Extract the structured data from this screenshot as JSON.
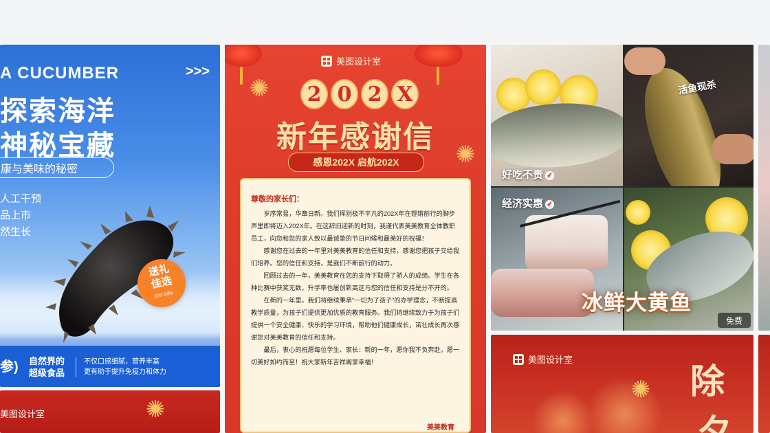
{
  "cards": {
    "sea_cucumber": {
      "en_title": "A CUCUMBER",
      "arrows": ">>>",
      "cn_line1": "探索海洋",
      "cn_line2": "神秘宝藏",
      "pill": "康与美味的秘密",
      "features": [
        "人工干预",
        "品上市",
        "然生长"
      ],
      "badge_main": "送礼\n佳选",
      "badge_sub": "Gift Gifts",
      "bottom_paren": "参)",
      "bottom_name": "自然界的\n超级食品",
      "bottom_desc": "不仅口感细腻，营养丰富\n更有助于提升免疫力和体力"
    },
    "sea_cucumber_below": {
      "brand": "美图设计室"
    },
    "letter": {
      "brand": "美图设计室",
      "year_chars": [
        "2",
        "0",
        "2",
        "X"
      ],
      "title": "新年感谢信",
      "ribbon": "感恩202X 启航202X",
      "greeting": "尊敬的家长们：",
      "paragraphs": [
        "岁序常易，华章日新。我们挥别极不平凡的202X年在铿锵前行的脚步声里即将迈入202X年。在这辞旧迎新的时刻，我谨代表美美教育全体教职员工，向您和您的家人致以最诚挚的节日问候和最美好的祝福！",
        "感谢您在过去的一年里对美美教育的信任和支持，感谢您把孩子交给我们培养。您的信任和支持，是我们不断前行的动力。",
        "回顾过去的一年，美美教育在您的支持下取得了骄人的成绩。学生在各种比赛中获奖无数，升学率也屡创新高这与您的信任和支持是分不开的。",
        "在新的一年里，我们将继续秉承“一切为了孩子”的办学理念，不断提高教学质量，为孩子们提供更加优质的教育服务。我们将继续致力于为孩子们提供一个安全健康、快乐的学习环境，帮助他们健康成长，茁壮成长再次感谢您对美美教育的信任和支持。",
        "最后，衷心的祝愿每位学生、家长：新的一年，愿你我不负奔赴，愿一切美好如约而至！祝大家新年吉祥阖家幸福！"
      ],
      "signature": "美美教育"
    },
    "fish": {
      "tag_live": "活鱼现杀",
      "label_tasty": "好吃不贵",
      "label_value": "经济实惠",
      "big_title": "冰鲜大黄鱼",
      "free_badge": "免费"
    },
    "new_year_eve": {
      "brand": "美图设计室",
      "char1": "除",
      "char2": "夕"
    }
  },
  "colors": {
    "blue_brand": "#1b5fd6",
    "red_poster": "#e64431",
    "gold_text": "#fbe0a8",
    "orange_badge": "#f7822a"
  },
  "icons": {
    "logo": "meitu-logo-icon",
    "check": "check-circle-icon",
    "firework": "firework-icon",
    "lantern": "lantern-icon"
  }
}
